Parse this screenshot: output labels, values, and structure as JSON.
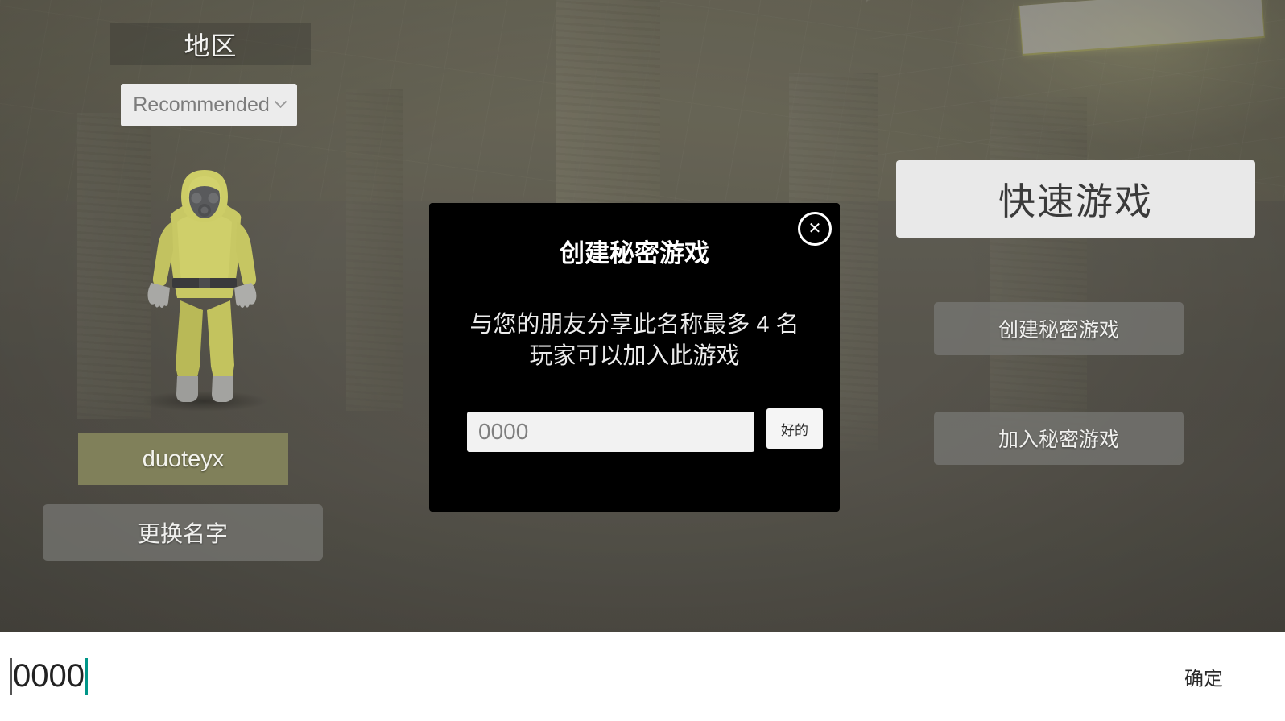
{
  "game": {
    "region": {
      "header_label": "地区",
      "selected_value": "Recommended",
      "chevron_icon": "chevron-down-icon"
    },
    "player": {
      "name": "duoteyx",
      "rename_button_label": "更换名字",
      "avatar_icon": "hazmat-character-avatar"
    },
    "menu": {
      "quick_game_label": "快速游戏",
      "create_secret_game_label": "创建秘密游戏",
      "join_secret_game_label": "加入秘密游戏"
    }
  },
  "modal": {
    "title": "创建秘密游戏",
    "body": "与您的朋友分享此名称最多 4 名玩家可以加入此游戏",
    "close_icon": "close-icon",
    "input_placeholder": "0000",
    "input_value": "",
    "ok_label": "好的"
  },
  "ime": {
    "composition_text": "0000",
    "confirm_label": "确定"
  },
  "colors": {
    "modal_bg": "#000000",
    "name_badge_bg": "#80805a",
    "quick_game_bg": "#e9e9e9",
    "secret_button_bg": "#767672",
    "ime_caret": "#009688",
    "region_select_bg": "#ececec"
  }
}
